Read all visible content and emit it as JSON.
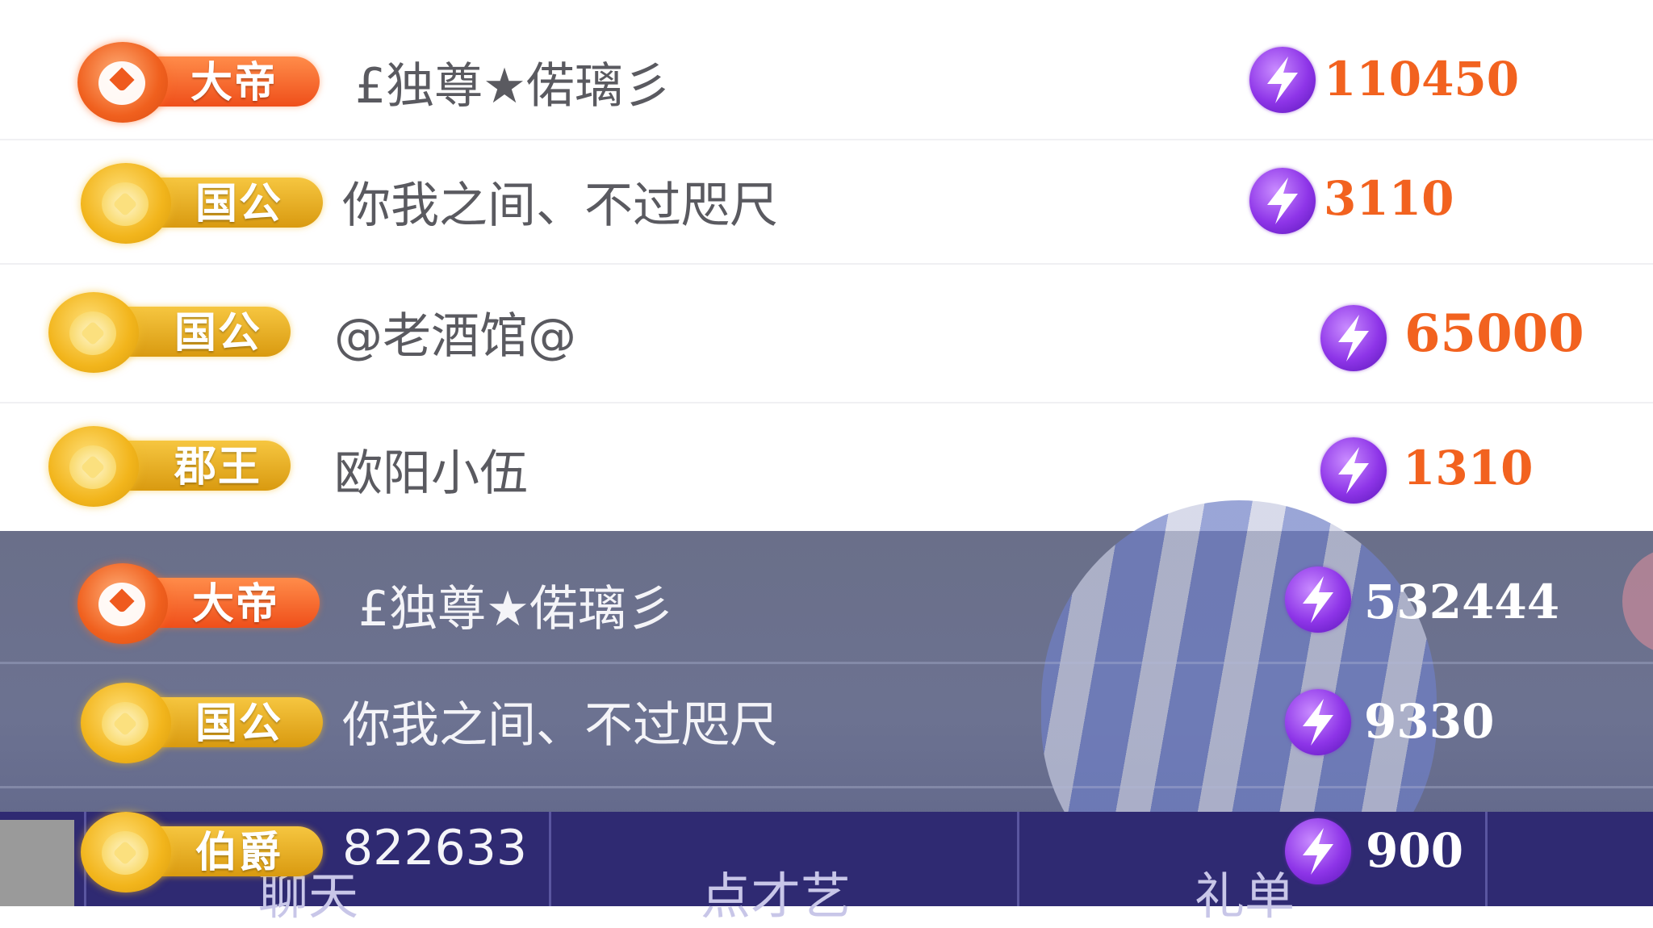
{
  "rows": [
    {
      "rank": "大帝",
      "name": "£独尊★偌璃彡",
      "score": "110450"
    },
    {
      "rank": "国公",
      "name": "你我之间、不过咫尺",
      "score": "3110"
    },
    {
      "rank": "国公",
      "name": "@老酒馆@",
      "score": "65000"
    },
    {
      "rank": "郡王",
      "name": "欧阳小伍",
      "score": "1310"
    },
    {
      "rank": "大帝",
      "name": "£独尊★偌璃彡",
      "score": "532444"
    },
    {
      "rank": "国公",
      "name": "你我之间、不过咫尺",
      "score": "9330"
    },
    {
      "rank": "伯爵",
      "name": "822633",
      "score": "900"
    }
  ],
  "tabs": [
    "聊天",
    "点才艺",
    "礼单"
  ],
  "colors": {
    "score_orange": "#f2621f",
    "tab_bar": "#2f2a72",
    "coin_purple": "#8e35e8"
  }
}
